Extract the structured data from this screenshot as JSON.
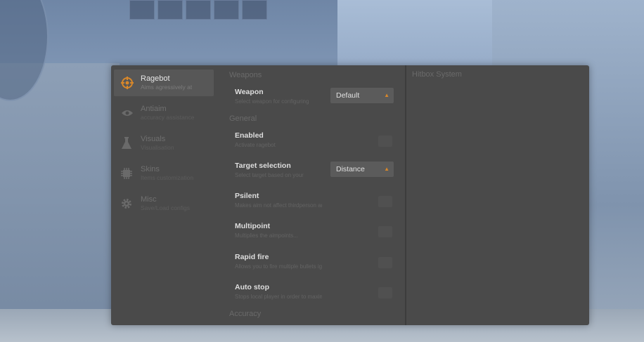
{
  "sidebar": {
    "items": [
      {
        "title": "Ragebot",
        "subtitle": "Aims agressively at",
        "icon": "crosshair-icon"
      },
      {
        "title": "Antiaim",
        "subtitle": "accuracy assistance",
        "icon": "eye-icon"
      },
      {
        "title": "Visuals",
        "subtitle": "Visualisation",
        "icon": "flask-icon"
      },
      {
        "title": "Skins",
        "subtitle": "Items customization",
        "icon": "chip-icon"
      },
      {
        "title": "Misc",
        "subtitle": "Save/Load configs",
        "icon": "gear-icon"
      }
    ]
  },
  "sections": {
    "weapons": "Weapons",
    "general": "General",
    "accuracy": "Accuracy",
    "hitbox": "Hitbox System"
  },
  "rows": {
    "weapon": {
      "title": "Weapon",
      "subtitle": "Select weapon for configuring",
      "value": "Default"
    },
    "enabled": {
      "title": "Enabled",
      "subtitle": "Activate ragebot"
    },
    "target": {
      "title": "Target selection",
      "subtitle": "Select target based on your",
      "value": "Distance"
    },
    "psilent": {
      "title": "Psilent",
      "subtitle": "Makes aim not affect thirdperson angles"
    },
    "multipoint": {
      "title": "Multipoint",
      "subtitle": "Multiplies the aimpoints..."
    },
    "rapidfire": {
      "title": "Rapid fire",
      "subtitle": "Allows you to fire multiple bullets ignoring"
    },
    "autostop": {
      "title": "Auto stop",
      "subtitle": "Stops local player in order to maximize accuracy"
    }
  },
  "colors": {
    "accent": "#d7872a",
    "panel": "#4a4a4a"
  }
}
